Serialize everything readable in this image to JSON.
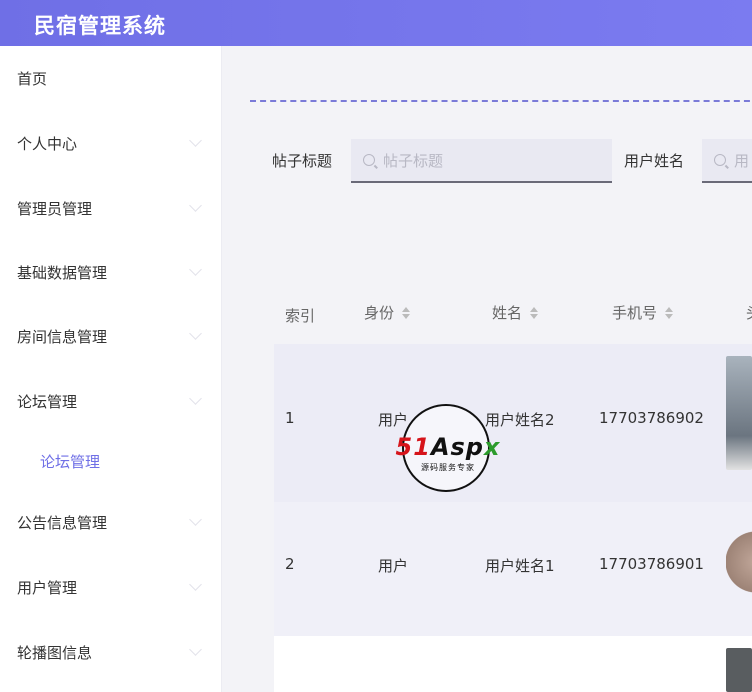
{
  "app": {
    "title": "民宿管理系统"
  },
  "sidebar": {
    "items": [
      {
        "label": "首页",
        "has_chevron": false
      },
      {
        "label": "个人中心",
        "has_chevron": true
      },
      {
        "label": "管理员管理",
        "has_chevron": true
      },
      {
        "label": "基础数据管理",
        "has_chevron": true
      },
      {
        "label": "房间信息管理",
        "has_chevron": true
      },
      {
        "label": "论坛管理",
        "has_chevron": true
      },
      {
        "label": "论坛管理",
        "sub": true,
        "active": true
      },
      {
        "label": "公告信息管理",
        "has_chevron": true
      },
      {
        "label": "用户管理",
        "has_chevron": true
      },
      {
        "label": "轮播图信息",
        "has_chevron": true
      }
    ]
  },
  "filters": {
    "post_title_label": "帖子标题",
    "post_title_placeholder": "帖子标题",
    "user_name_label": "用户姓名",
    "user_name_placeholder": "用"
  },
  "table": {
    "headers": [
      "索引",
      "身份",
      "姓名",
      "手机号",
      "头"
    ],
    "rows": [
      {
        "index": "1",
        "role": "用户",
        "name": "用户姓名2",
        "phone": "17703786902"
      },
      {
        "index": "2",
        "role": "用户",
        "name": "用户姓名1",
        "phone": "17703786901"
      }
    ]
  },
  "watermark": {
    "part1": "51",
    "part2": "Asp",
    "part3": "x",
    "subtitle": "源码服务专家"
  }
}
